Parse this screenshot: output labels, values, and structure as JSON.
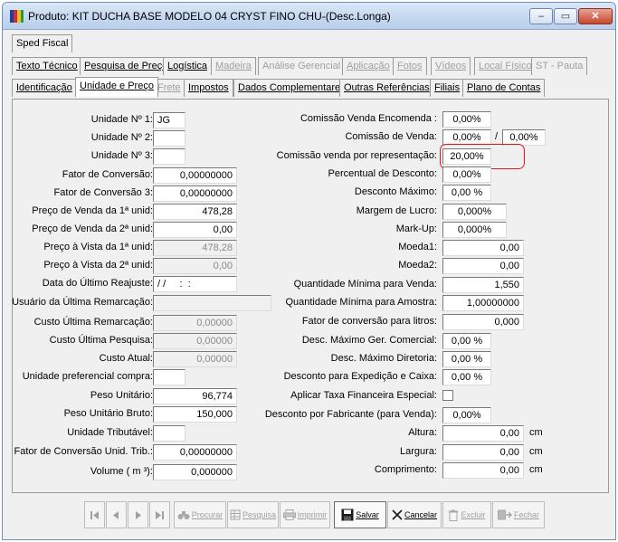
{
  "window": {
    "title": "Produto: KIT DUCHA BASE MODELO 04 CRYST FINO CHU-(Desc.Longa)",
    "controls": {
      "minimize": "–",
      "maximize": "▭",
      "close": "✕"
    }
  },
  "tabs": {
    "row1": [
      {
        "label": "Sped Fiscal",
        "enabled": true
      }
    ],
    "row2": [
      {
        "label": "Texto Técnico",
        "enabled": true
      },
      {
        "label": "Pesquisa de Preço",
        "enabled": true
      },
      {
        "label": "Logística",
        "enabled": true
      },
      {
        "label": "Madeira",
        "enabled": false
      },
      {
        "label": "Análise Gerencial",
        "enabled": false
      },
      {
        "label": "Aplicação",
        "enabled": false
      },
      {
        "label": "Fotos",
        "enabled": false
      },
      {
        "label": "Vídeos",
        "enabled": false
      },
      {
        "label": "Local Físico",
        "enabled": false
      },
      {
        "label": "ST - Pauta",
        "enabled": false
      }
    ],
    "row3": [
      {
        "label": "Identificação",
        "enabled": true
      },
      {
        "label": "Unidade e Preço",
        "enabled": true,
        "active": true
      },
      {
        "label": "Frete",
        "enabled": false
      },
      {
        "label": "Impostos",
        "enabled": true
      },
      {
        "label": "Dados Complementares",
        "enabled": true
      },
      {
        "label": "Outras Referências",
        "enabled": true
      },
      {
        "label": "Filiais",
        "enabled": true
      },
      {
        "label": "Plano de Contas",
        "enabled": true
      }
    ]
  },
  "left_fields": {
    "unidade1": {
      "label": "Unidade Nº 1:",
      "value": "JG"
    },
    "unidade2": {
      "label": "Unidade Nº 2:",
      "value": ""
    },
    "unidade3": {
      "label": "Unidade Nº 3:",
      "value": ""
    },
    "fator_conversao": {
      "label": "Fator de Conversão:",
      "value": "0,00000000"
    },
    "fator_conversao3": {
      "label": "Fator de Conversão 3:",
      "value": "0,00000000"
    },
    "preco_venda_1": {
      "label": "Preço de Venda da 1ª unid:",
      "value": "478,28"
    },
    "preco_venda_2": {
      "label": "Preço de Venda da 2ª unid:",
      "value": "0,00"
    },
    "preco_vista_1": {
      "label": "Preço à Vista da 1ª unid:",
      "value": "478,28"
    },
    "preco_vista_2": {
      "label": "Preço à Vista da 2ª unid:",
      "value": "0,00"
    },
    "data_reajuste": {
      "label": "Data do Último Reajuste:",
      "value": "/ /     :  :"
    },
    "usuario_remarcacao": {
      "label": "Usuário da Última Remarcação:",
      "value": ""
    },
    "custo_remarcacao": {
      "label": "Custo Última Remarcação:",
      "value": "0,00000"
    },
    "custo_pesquisa": {
      "label": "Custo Última Pesquisa:",
      "value": "0,00000"
    },
    "custo_atual": {
      "label": "Custo Atual:",
      "value": "0,00000"
    },
    "unidade_pref_compra": {
      "label": "Unidade preferencial compra:",
      "value": ""
    },
    "peso_unitario": {
      "label": "Peso Unitário:",
      "value": "96,774"
    },
    "peso_bruto": {
      "label": "Peso Unitário Bruto:",
      "value": "150,000"
    },
    "unidade_tributavel": {
      "label": "Unidade Tributável:",
      "value": ""
    },
    "fator_conv_trib": {
      "label": "Fator de Conversão Unid. Trib.:",
      "value": "0,00000000"
    },
    "volume": {
      "label": "Volume ( m ³):",
      "value": "0,000000"
    }
  },
  "right_fields": {
    "comissao_encomenda": {
      "label": "Comissão Venda Encomenda :",
      "value": "0,00%"
    },
    "comissao_venda": {
      "label": "Comissão de Venda:",
      "value": "0,00%",
      "separator": "/",
      "value2": "0,00%"
    },
    "comissao_representacao": {
      "label": "Comissão venda por representação:",
      "value": "20,00%"
    },
    "percentual_desconto": {
      "label": "Percentual de Desconto:",
      "value": "0,00%"
    },
    "desconto_maximo": {
      "label": "Desconto Máximo:",
      "value": "0,00 %"
    },
    "margem_lucro": {
      "label": "Margem de Lucro:",
      "value": "0,000%"
    },
    "markup": {
      "label": "Mark-Up:",
      "value": "0,000%"
    },
    "moeda1": {
      "label": "Moeda1:",
      "value": "0,00"
    },
    "moeda2": {
      "label": "Moeda2:",
      "value": "0,00"
    },
    "qtd_min_venda": {
      "label": "Quantidade Mínima para Venda:",
      "value": "1,550"
    },
    "qtd_min_amostra": {
      "label": "Quantidade Mínima para Amostra:",
      "value": "1,00000000"
    },
    "fator_litros": {
      "label": "Fator de conversão para litros:",
      "value": "0,000"
    },
    "desc_max_comercial": {
      "label": "Desc. Máximo Ger. Comercial:",
      "value": "0,00 %"
    },
    "desc_max_diretoria": {
      "label": "Desc. Máximo Diretoria:",
      "value": "0,00 %"
    },
    "desc_expedicao": {
      "label": "Desconto para Expedição e Caixa:",
      "value": "0,00 %"
    },
    "taxa_financeira": {
      "label": "Aplicar Taxa Financeira Especial:"
    },
    "desc_fabricante": {
      "label": "Desconto por Fabricante (para Venda):",
      "value": "0,00%"
    },
    "altura": {
      "label": "Altura:",
      "value": "0,00",
      "unit": "cm"
    },
    "largura": {
      "label": "Largura:",
      "value": "0,00",
      "unit": "cm"
    },
    "comprimento": {
      "label": "Comprimento:",
      "value": "0,00",
      "unit": "cm"
    }
  },
  "toolbar": {
    "procurar": "Procurar",
    "pesquisa": "Pesquisa",
    "imprimir": "Imprimir",
    "salvar": "Salvar",
    "cancelar": "Cancelar",
    "excluir": "Excluir",
    "fechar": "Fechar"
  },
  "colors": {
    "highlight": "#e0191c",
    "titlebar": "#c4d7ef",
    "disabled_text": "#a0a0a0"
  }
}
